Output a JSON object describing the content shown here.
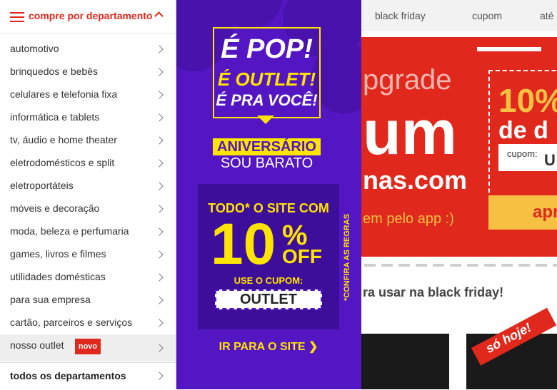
{
  "top_nav": {
    "items": [
      "black friday",
      "cupom",
      "até"
    ]
  },
  "menu": {
    "title": "compre por departamento",
    "items": [
      "automotivo",
      "brinquedos e bebês",
      "celulares e telefonia fixa",
      "informática e tablets",
      "tv, áudio e home theater",
      "eletrodomésticos e split",
      "eletroportáteis",
      "móveis e decoração",
      "moda, beleza e perfumaria",
      "games, livros e filmes",
      "utilidades domésticas",
      "para sua empresa",
      "cartão, parceiros e serviços"
    ],
    "highlight_item": {
      "label": "nosso outlet",
      "badge": "novo"
    },
    "all_departments": "todos os departamentos"
  },
  "promo": {
    "line1": "É POP!",
    "line2": "É OUTLET!",
    "line3": "É PRA VOCÊ!",
    "aniversario": "ANIVERSÁRIO",
    "sou_barato": "SOU BARATO",
    "todo_site": "TODO* O SITE COM",
    "discount_number": "10",
    "discount_pct": "%",
    "discount_off": "OFF",
    "use_cupom": "USE O CUPOM:",
    "coupon_code": "OUTLET",
    "confira": "*CONFIRA AS REGRAS",
    "cta": "IR PARA O SITE ❯"
  },
  "hero": {
    "upgrade": "pgrade",
    "big_word": "um",
    "dotcom": "nas.com",
    "app_text": "em pelo app :)",
    "pct": "10%",
    "de": "de d",
    "cupom_label": "cupom:",
    "cupom_value": "U",
    "btn": "apr"
  },
  "section_title": "ra usar na black friday!",
  "so_hoje": "só hoje!",
  "colors": {
    "brand_red": "#e0281c",
    "promo_purple": "#5316c2",
    "promo_yellow": "#ffe400"
  }
}
